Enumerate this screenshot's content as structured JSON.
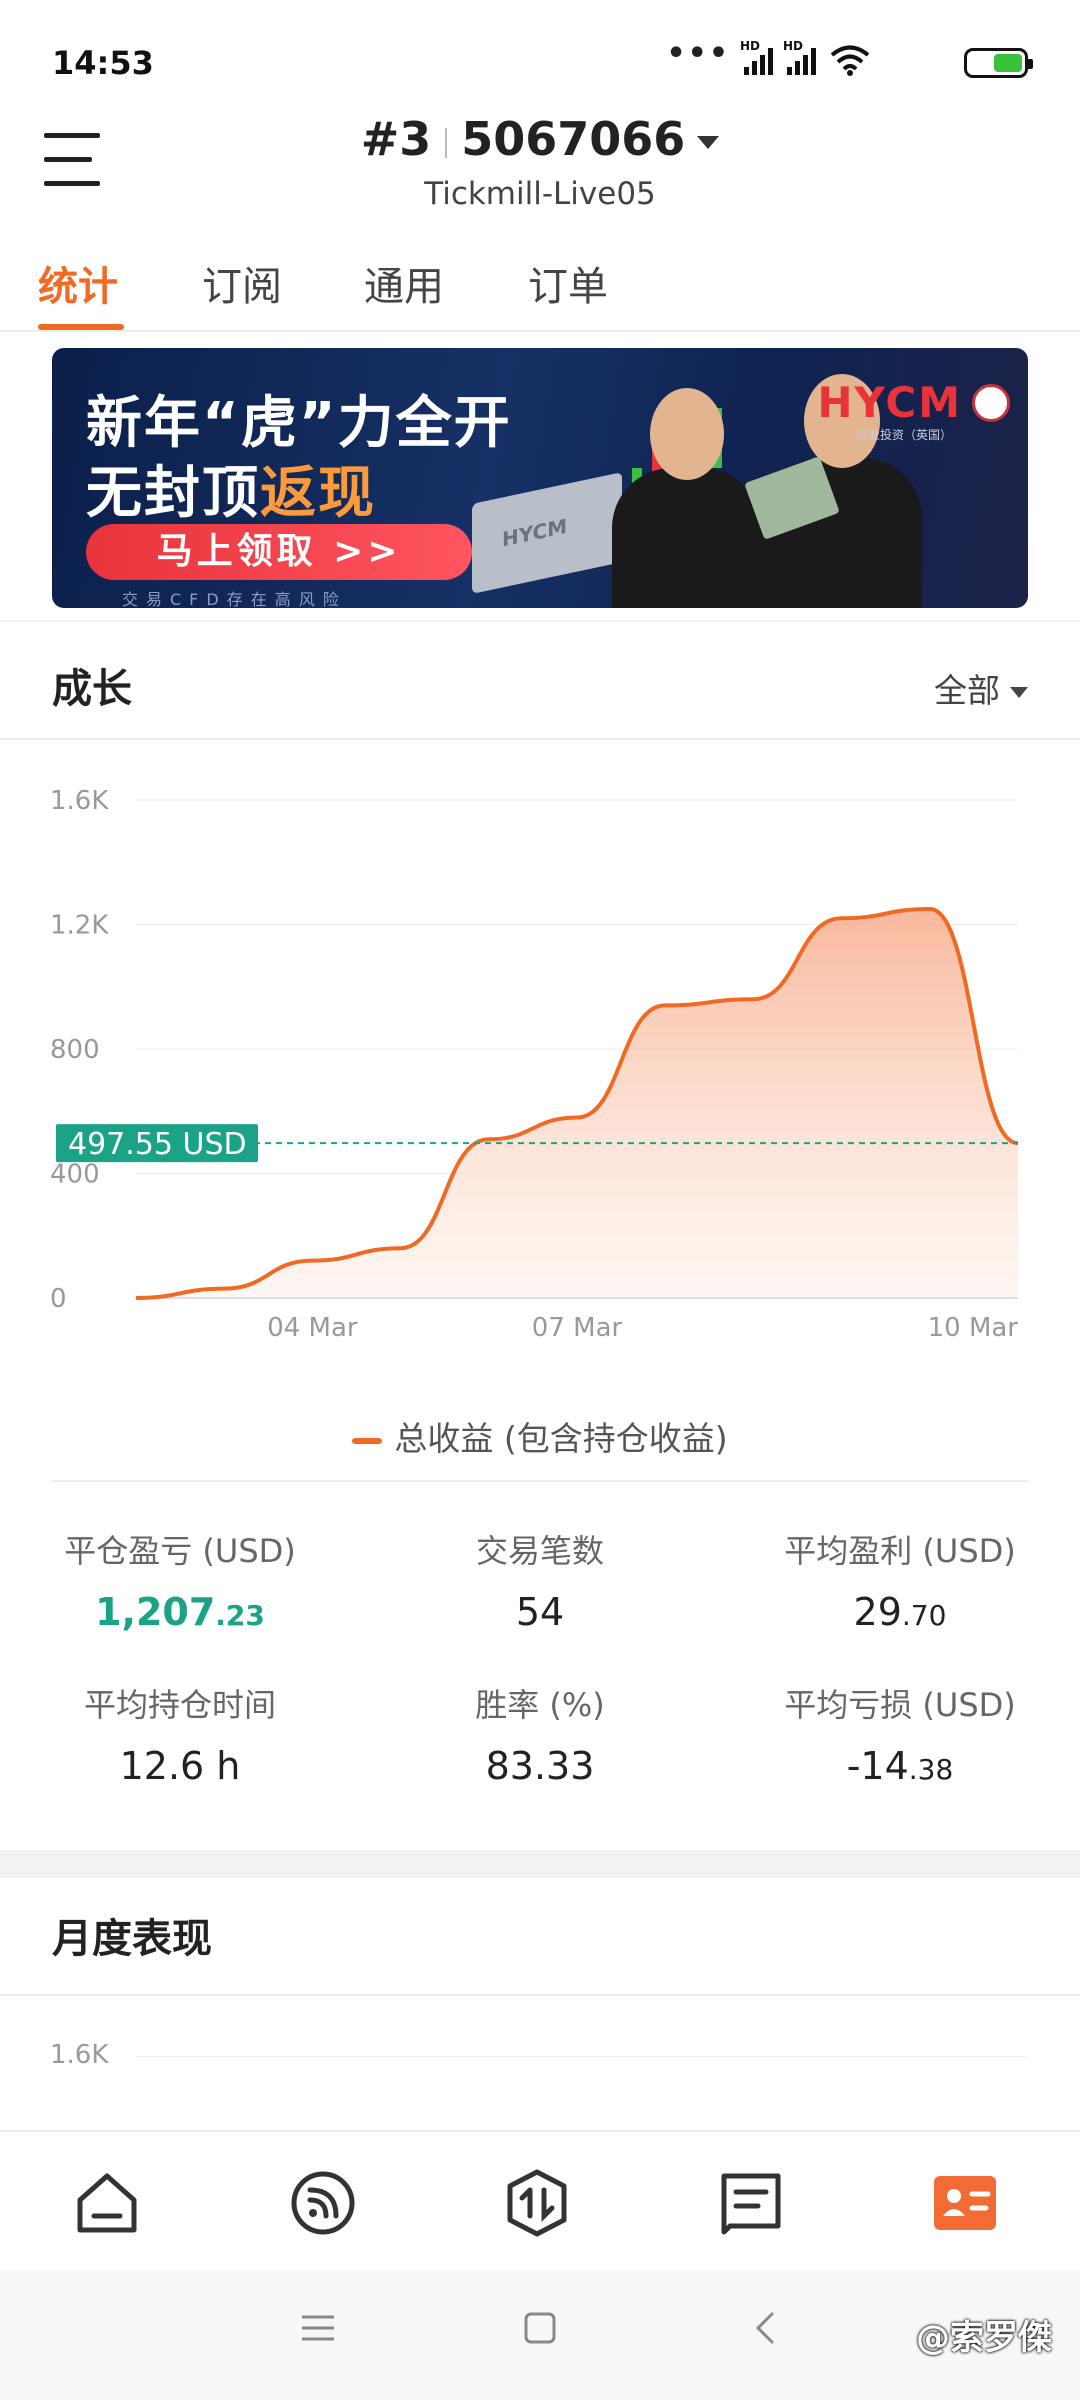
{
  "status_bar": {
    "time": "14:53",
    "signal_badges": [
      "HD",
      "HD"
    ]
  },
  "header": {
    "account_index": "#3",
    "account_number": "5067066",
    "server": "Tickmill-Live05"
  },
  "tabs": [
    {
      "label": "统计",
      "active": true
    },
    {
      "label": "订阅",
      "active": false
    },
    {
      "label": "通用",
      "active": false
    },
    {
      "label": "订单",
      "active": false
    }
  ],
  "banner": {
    "line1": "新年“虎”力全开",
    "line2_prefix": "无封顶",
    "line2_highlight": "返现",
    "cta": "马上领取 >>",
    "risk_note": "交易CFD存在高风险",
    "logo": "HYCM",
    "logo_sub": "兴业投资（英国）",
    "laptop_brand": "HYCM"
  },
  "growth": {
    "title": "成长",
    "filter": "全部",
    "current_value_label": "497.55 USD",
    "legend": "总收益 (包含持仓收益)"
  },
  "chart_data": {
    "type": "area",
    "x": [
      "02 Mar",
      "03 Mar",
      "04 Mar",
      "05 Mar",
      "06 Mar",
      "07 Mar",
      "08 Mar",
      "08 Mar",
      "09 Mar",
      "09 Mar",
      "10 Mar"
    ],
    "y": [
      0,
      30,
      120,
      160,
      510,
      580,
      940,
      960,
      1220,
      1250,
      497.55
    ],
    "xticks": [
      "04 Mar",
      "07 Mar",
      "10 Mar"
    ],
    "yticks": [
      "0",
      "400",
      "800",
      "1.2K",
      "1.6K"
    ],
    "ylim": [
      0,
      1600
    ],
    "reference_line": 497.55,
    "series": [
      {
        "name": "总收益 (包含持仓收益)",
        "color": "#f06a24"
      }
    ],
    "grid": true
  },
  "stats": [
    {
      "label": "平仓盈亏 (USD)",
      "int": "1,207",
      "dec": ".23",
      "highlight": true
    },
    {
      "label": "交易笔数",
      "int": "54",
      "dec": "",
      "highlight": false
    },
    {
      "label": "平均盈利 (USD)",
      "int": "29",
      "dec": ".70",
      "highlight": false
    },
    {
      "label": "平均持仓时间",
      "int": "12.6 h",
      "dec": "",
      "highlight": false
    },
    {
      "label": "胜率 (%)",
      "int": "83.33",
      "dec": "",
      "highlight": false
    },
    {
      "label": "平均亏损 (USD)",
      "int": "-14",
      "dec": ".38",
      "highlight": false
    }
  ],
  "monthly": {
    "title": "月度表现",
    "first_tick": "1.6K"
  },
  "bottom_nav": [
    "home-icon",
    "feed-icon",
    "trade-icon",
    "messages-icon",
    "profile-icon"
  ],
  "watermark": "@索罗傑"
}
